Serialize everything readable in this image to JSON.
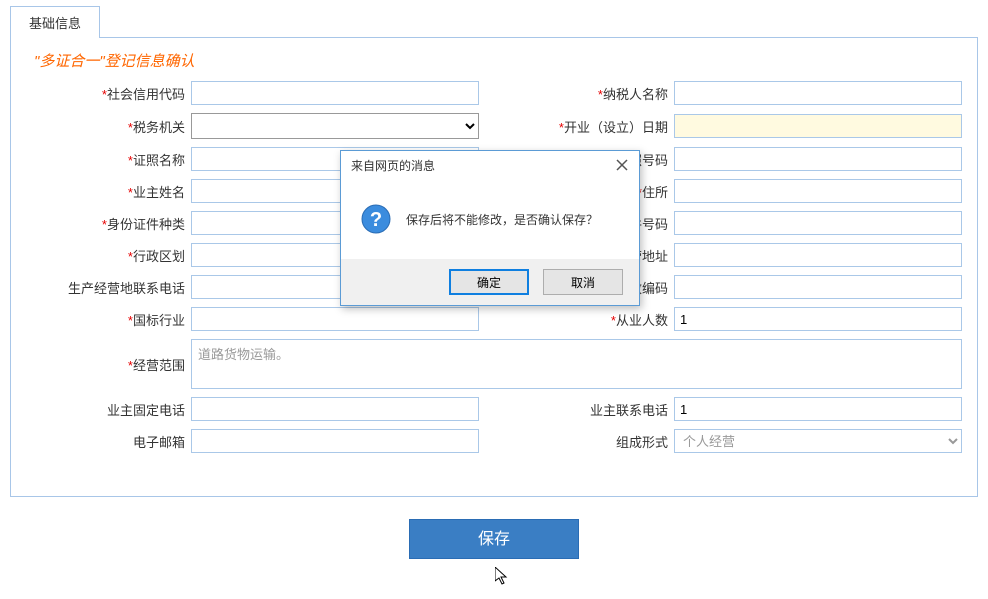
{
  "tab": {
    "label": "基础信息"
  },
  "section_title": "\"多证合一\"登记信息确认",
  "fields": {
    "social_credit_code": {
      "label": "社会信用代码",
      "value": ""
    },
    "taxpayer_name": {
      "label": "纳税人名称",
      "value": ""
    },
    "tax_authority": {
      "label": "税务机关",
      "value": ""
    },
    "open_date": {
      "label": "开业（设立）日期",
      "value": ""
    },
    "cert_name": {
      "label": "证照名称",
      "value": ""
    },
    "cert_number": {
      "label": "照号码",
      "value": ""
    },
    "owner_name": {
      "label": "业主姓名",
      "value": ""
    },
    "address": {
      "label": "住所",
      "value": ""
    },
    "id_type": {
      "label": "身份证件种类",
      "value": ""
    },
    "id_number": {
      "label": "件号码",
      "value": ""
    },
    "admin_division": {
      "label": "行政区划",
      "value": ""
    },
    "biz_address": {
      "label": "营地址",
      "value": ""
    },
    "biz_phone": {
      "label": "生产经营地联系电话",
      "value": ""
    },
    "postal_code": {
      "label": "政编码",
      "value": ""
    },
    "industry": {
      "label": "国标行业",
      "value": ""
    },
    "employee_count": {
      "label": "从业人数",
      "value": "1"
    },
    "biz_scope": {
      "label": "经营范围",
      "value": "道路货物运输。"
    },
    "owner_fixed_phone": {
      "label": "业主固定电话",
      "value": ""
    },
    "owner_contact_phone": {
      "label": "业主联系电话",
      "value": "1"
    },
    "email": {
      "label": "电子邮箱",
      "value": ""
    },
    "composition": {
      "label": "组成形式",
      "value": "个人经营"
    }
  },
  "save_button": "保存",
  "modal": {
    "title": "来自网页的消息",
    "message": "保存后将不能修改，是否确认保存？",
    "ok": "确定",
    "cancel": "取消"
  }
}
